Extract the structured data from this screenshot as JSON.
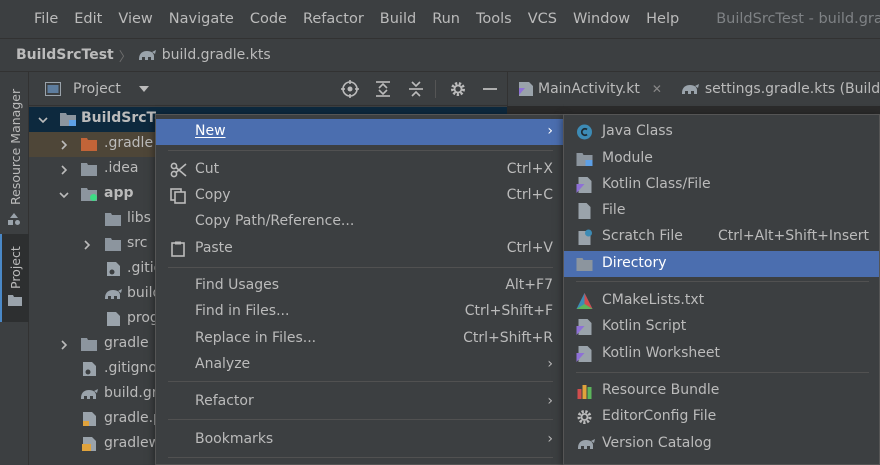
{
  "menubar": {
    "items": [
      "File",
      "Edit",
      "View",
      "Navigate",
      "Code",
      "Refactor",
      "Build",
      "Run",
      "Tools",
      "VCS",
      "Window",
      "Help"
    ],
    "window_title": "BuildSrcTest - build.gradle"
  },
  "breadcrumb": {
    "root": "BuildSrcTest",
    "file": "build.gradle.kts"
  },
  "side_tabs": {
    "resource_manager": "Resource Manager",
    "project": "Project"
  },
  "project_panel": {
    "title": "Project"
  },
  "editor_tabs": [
    {
      "label": "MainActivity.kt"
    },
    {
      "label": "settings.gradle.kts (BuildSrc"
    }
  ],
  "tree": [
    {
      "label": "BuildSrcTe",
      "bold": true
    },
    {
      "label": ".gradle"
    },
    {
      "label": ".idea"
    },
    {
      "label": "app",
      "bold": true
    },
    {
      "label": "libs"
    },
    {
      "label": "src"
    },
    {
      "label": ".gitig"
    },
    {
      "label": "build"
    },
    {
      "label": "prog"
    },
    {
      "label": "gradle"
    },
    {
      "label": ".gitigno"
    },
    {
      "label": "build.gr"
    },
    {
      "label": "gradle.p"
    },
    {
      "label": "gradlew"
    }
  ],
  "context_menu": {
    "items": [
      {
        "label": "New",
        "shortcut": "",
        "submenu": true,
        "mnemonic": "N"
      },
      {
        "label": "Cut",
        "shortcut": "Ctrl+X",
        "icon": "scissors-icon"
      },
      {
        "label": "Copy",
        "shortcut": "Ctrl+C",
        "icon": "copy-icon"
      },
      {
        "label": "Copy Path/Reference...",
        "shortcut": ""
      },
      {
        "label": "Paste",
        "shortcut": "Ctrl+V",
        "icon": "clipboard-icon"
      },
      {
        "label": "Find Usages",
        "shortcut": "Alt+F7"
      },
      {
        "label": "Find in Files...",
        "shortcut": "Ctrl+Shift+F"
      },
      {
        "label": "Replace in Files...",
        "shortcut": "Ctrl+Shift+R"
      },
      {
        "label": "Analyze",
        "shortcut": "",
        "submenu": true
      },
      {
        "label": "Refactor",
        "shortcut": "",
        "submenu": true
      },
      {
        "label": "Bookmarks",
        "shortcut": "",
        "submenu": true
      }
    ]
  },
  "new_submenu": {
    "items": [
      {
        "label": "Java Class",
        "icon": "java-class-icon"
      },
      {
        "label": "Module",
        "icon": "module-icon"
      },
      {
        "label": "Kotlin Class/File",
        "icon": "kotlin-file-icon"
      },
      {
        "label": "File",
        "icon": "file-icon"
      },
      {
        "label": "Scratch File",
        "shortcut": "Ctrl+Alt+Shift+Insert",
        "icon": "scratch-file-icon"
      },
      {
        "label": "Directory",
        "icon": "folder-icon",
        "selected": true
      },
      {
        "label": "CMakeLists.txt",
        "icon": "cmake-icon"
      },
      {
        "label": "Kotlin Script",
        "icon": "kotlin-script-icon"
      },
      {
        "label": "Kotlin Worksheet",
        "icon": "kotlin-worksheet-icon"
      },
      {
        "label": "Resource Bundle",
        "icon": "resource-bundle-icon"
      },
      {
        "label": "EditorConfig File",
        "icon": "gear-icon"
      },
      {
        "label": "Version Catalog",
        "icon": "gradle-elephant-icon"
      }
    ]
  },
  "colors": {
    "selection": "#4b6eaf",
    "panel": "#3c3f41",
    "text": "#bbbbbb",
    "android_green": "#3ddc84",
    "folder_gray": "#8c959e",
    "excluded_folder": "#c26438"
  }
}
